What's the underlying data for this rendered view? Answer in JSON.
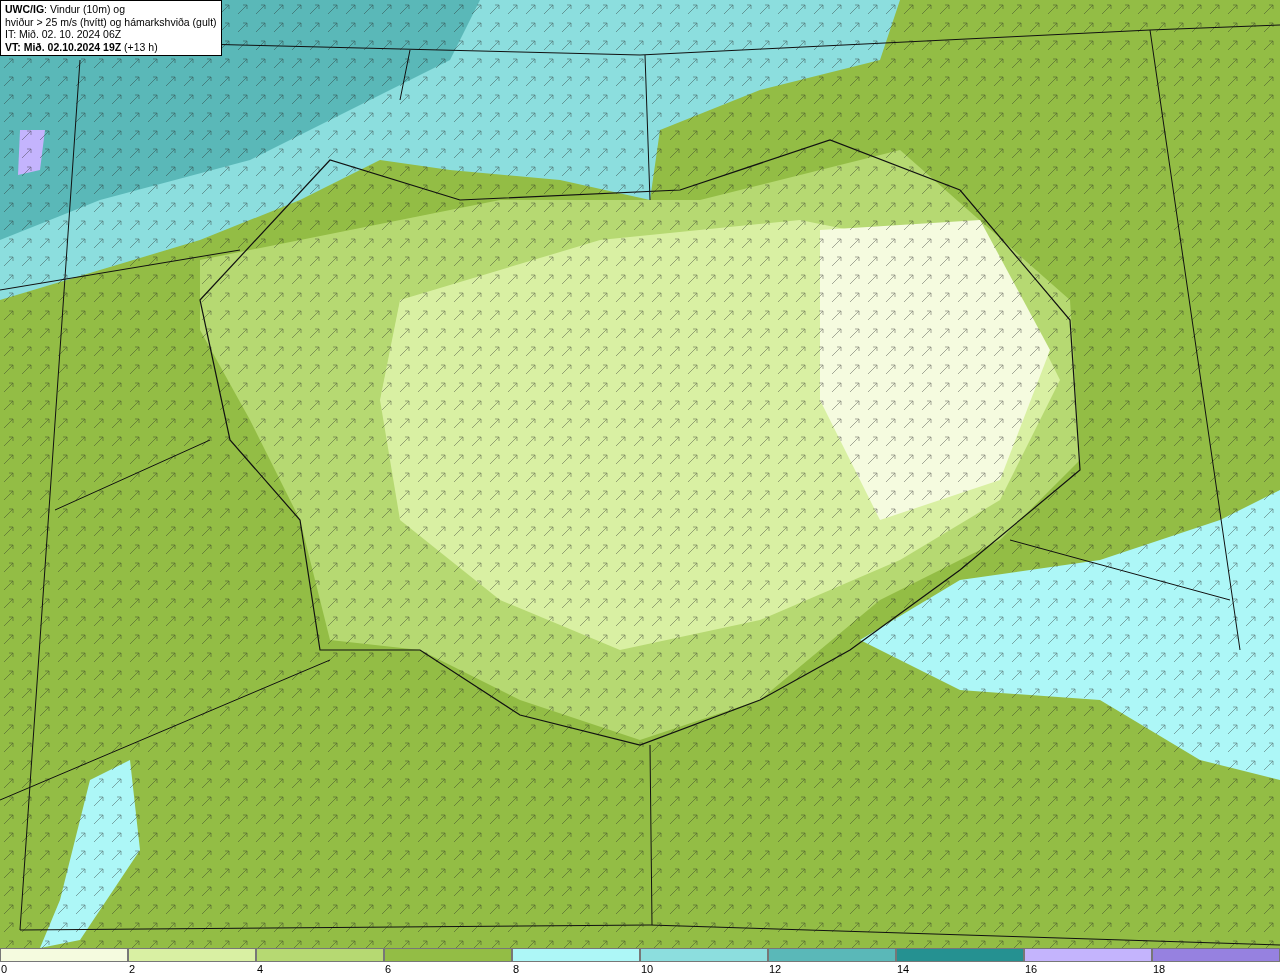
{
  "title_box": {
    "lines": [
      "**UWC/IG**: Vindur (10m) og",
      "hviður > 25 m/s (hvítt) og hámarkshviða (gult)",
      "IT: Mið. 02. 10. 2024 06Z",
      "**VT: Mið. 02.10.2024 19Z** (+13 h)"
    ]
  },
  "legend": [
    {
      "label": "0",
      "color": "#f5fbdf"
    },
    {
      "label": "2",
      "color": "#d9f0a3"
    },
    {
      "label": "4",
      "color": "#b6d972"
    },
    {
      "label": "6",
      "color": "#93bd45"
    },
    {
      "label": "8",
      "color": "#adf7f7"
    },
    {
      "label": "10",
      "color": "#8cdede"
    },
    {
      "label": "12",
      "color": "#5ab8b8"
    },
    {
      "label": "14",
      "color": "#259191"
    },
    {
      "label": "16",
      "color": "#c4b4fd"
    },
    {
      "label": "18",
      "color": "#9681e0"
    }
  ]
}
